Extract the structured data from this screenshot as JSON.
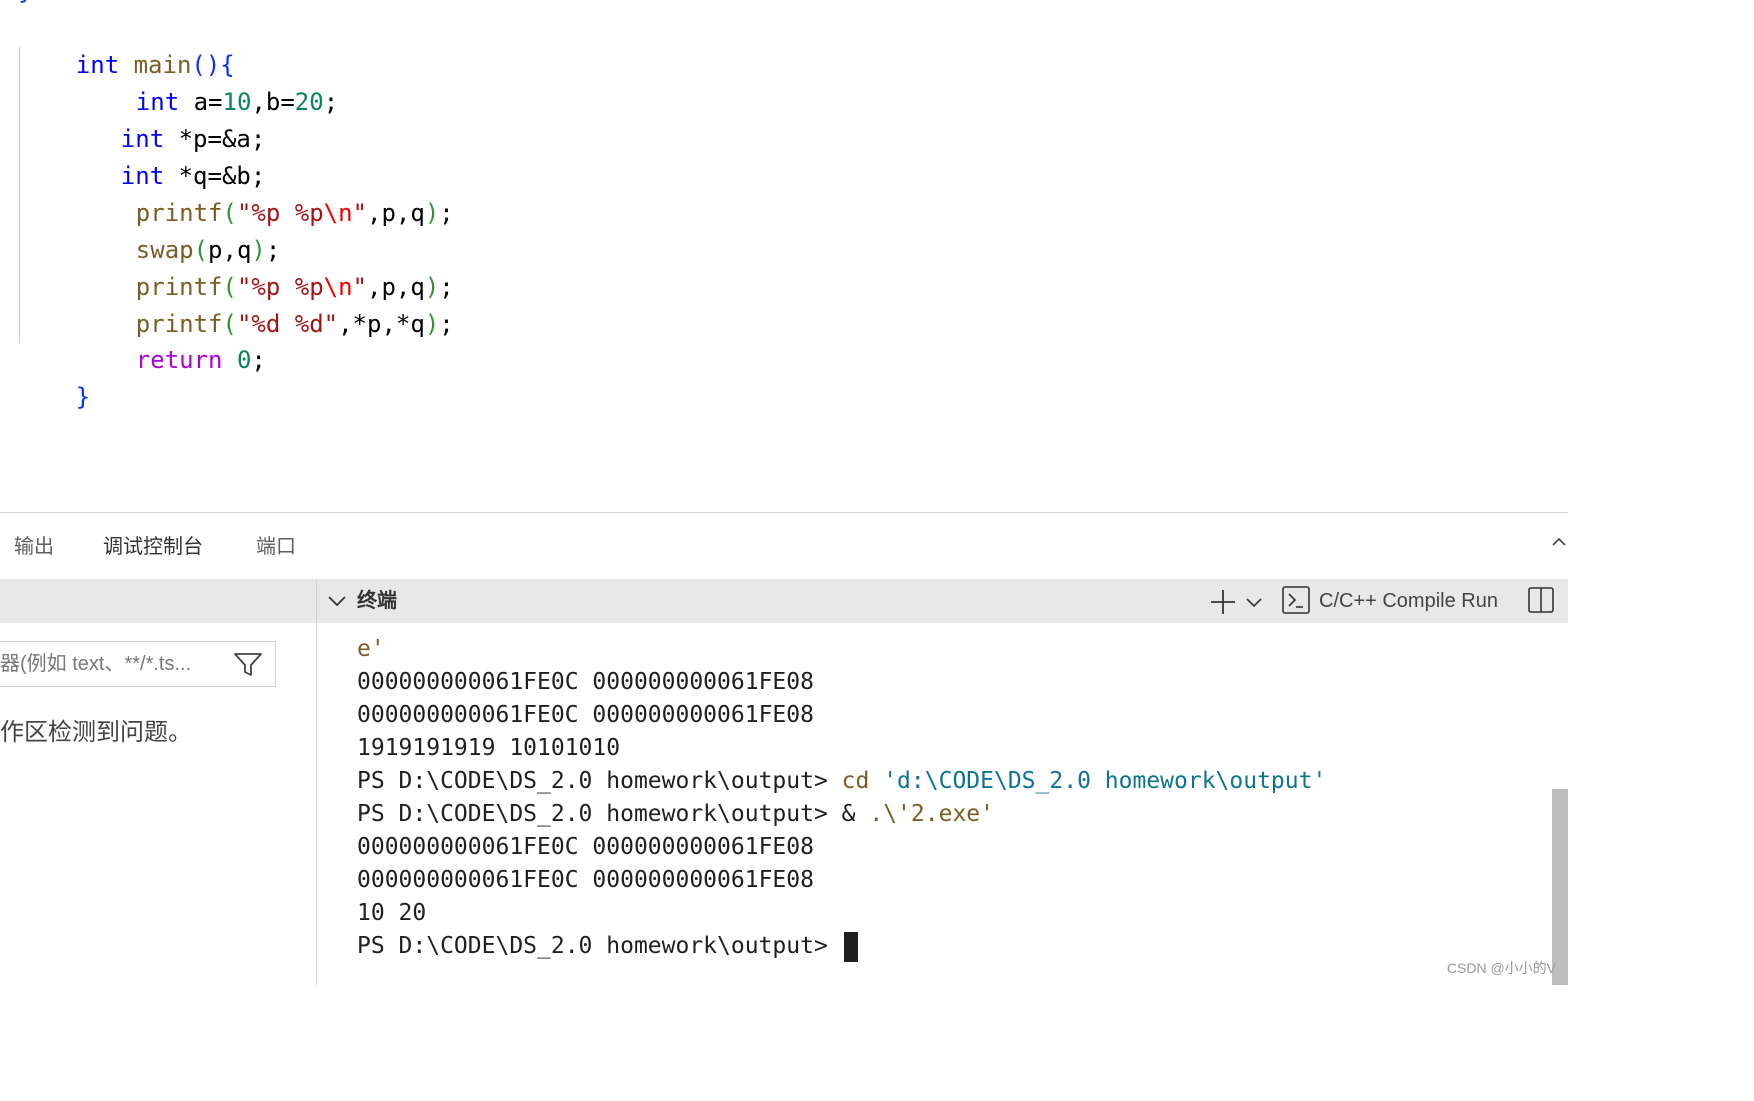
{
  "editor": {
    "prev_brace": "}",
    "lines": [
      "int main(){",
      "int a=10,b=20;",
      "int *p=&a;",
      "int *q=&b;",
      "printf(\"%p %p\\n\",p,q);",
      "swap(p,q);",
      "printf(\"%p %p\\n\",p,q);",
      "printf(\"%d %d\",*p,*q);",
      "return 0;",
      "}"
    ]
  },
  "panel": {
    "tabs": [
      {
        "label": "输出"
      },
      {
        "label": "调试控制台"
      },
      {
        "label": "端口"
      }
    ],
    "filter_placeholder": "器(例如 text、**/*.ts...",
    "problems_message": "作区检测到问题。",
    "terminal": {
      "title": "终端",
      "profile_label": "C/C++ Compile Run",
      "lines": [
        {
          "text": "e'",
          "type": "tail"
        },
        {
          "text": "000000000061FE0C 000000000061FE08",
          "type": "out"
        },
        {
          "text": "000000000061FE0C 000000000061FE08",
          "type": "out"
        },
        {
          "text": "1919191919 10101010",
          "type": "out"
        },
        {
          "prompt": "PS D:\\CODE\\DS_2.0 homework\\output> ",
          "cmd": "cd",
          "arg": " 'd:\\CODE\\DS_2.0 homework\\output'",
          "type": "cmd"
        },
        {
          "prompt": "PS D:\\CODE\\DS_2.0 homework\\output> ",
          "cmd": "& ",
          "arg": ".\\'2.exe'",
          "type": "cmd2"
        },
        {
          "text": "000000000061FE0C 000000000061FE08",
          "type": "out"
        },
        {
          "text": "000000000061FE0C 000000000061FE08",
          "type": "out"
        },
        {
          "text": "10 20",
          "type": "out"
        },
        {
          "prompt": "PS D:\\CODE\\DS_2.0 homework\\output> ",
          "type": "prompt"
        }
      ]
    }
  },
  "watermark": "CSDN @小小的V",
  "icons": [
    "chevron-up-icon",
    "filter-icon",
    "chevron-down-icon",
    "plus-icon",
    "dropdown-icon",
    "terminal-icon",
    "split-icon"
  ]
}
